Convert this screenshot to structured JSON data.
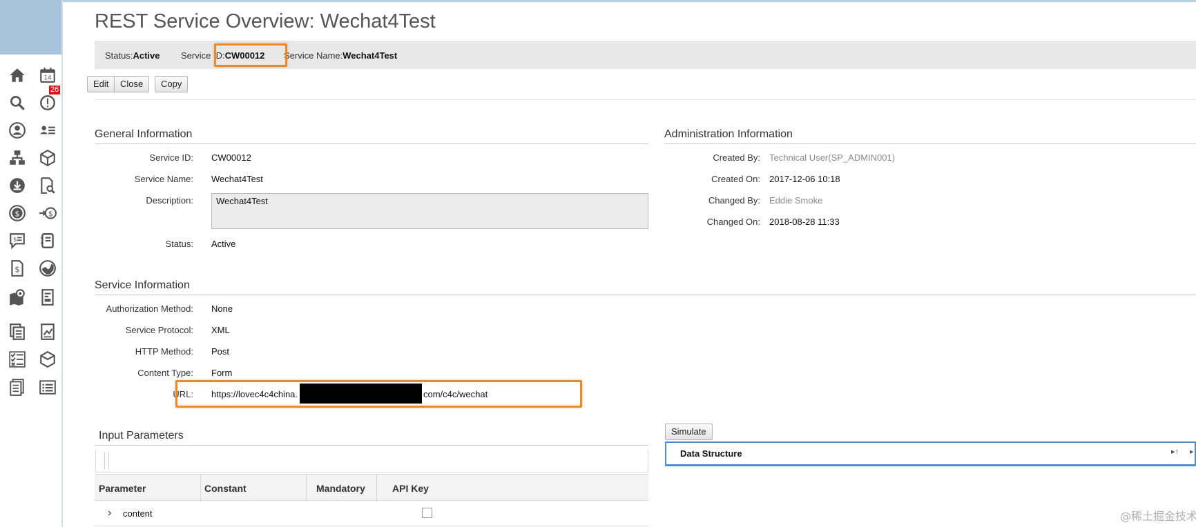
{
  "page": {
    "title": "REST Service Overview: Wechat4Test"
  },
  "rail": {
    "badge_count": "26",
    "icons": [
      "home-icon",
      "calendar-icon",
      "search-icon",
      "alert-icon",
      "person-icon",
      "contacts-list-icon",
      "org-chart-icon",
      "package-icon",
      "download-icon",
      "search-doc-icon",
      "dollar-icon",
      "transfer-dollar-icon",
      "chat-dollar-icon",
      "notebook-icon",
      "receipt-dollar-icon",
      "globe-chart-icon",
      "map-pin-icon",
      "report-icon",
      "documents-icon",
      "chart-doc-icon",
      "checklist-icon",
      "box-icon",
      "doc-list-icon",
      "list-icon"
    ]
  },
  "status_bar": {
    "status_label": "Status:",
    "status_value": "Active",
    "service_id_label": "Service ID:",
    "service_id_value": "CW00012",
    "service_name_label": "Service Name:",
    "service_name_value": "Wechat4Test"
  },
  "toolbar": {
    "edit": "Edit",
    "close": "Close",
    "copy": "Copy"
  },
  "general": {
    "title": "General Information",
    "service_id_label": "Service ID:",
    "service_id_value": "CW00012",
    "service_name_label": "Service Name:",
    "service_name_value": "Wechat4Test",
    "description_label": "Description:",
    "description_value": "Wechat4Test",
    "status_label": "Status:",
    "status_value": "Active"
  },
  "admin": {
    "title": "Administration Information",
    "created_by_label": "Created By:",
    "created_by_value": "Technical User(SP_ADMIN001)",
    "created_on_label": "Created On:",
    "created_on_value": "2017-12-06 10:18",
    "changed_by_label": "Changed By:",
    "changed_by_value": "Eddie Smoke",
    "changed_on_label": "Changed On:",
    "changed_on_value": "2018-08-28 11:33"
  },
  "service_info": {
    "title": "Service Information",
    "auth_label": "Authorization Method:",
    "auth_value": "None",
    "protocol_label": "Service Protocol:",
    "protocol_value": "XML",
    "http_label": "HTTP Method:",
    "http_value": "Post",
    "content_label": "Content Type:",
    "content_value": "Form",
    "url_label": "URL:",
    "url_prefix": "https://lovec4c4china.",
    "url_suffix": "com/c4c/wechat"
  },
  "input_params": {
    "title": "Input Parameters",
    "columns": [
      "Parameter",
      "Constant",
      "Mandatory",
      "API Key"
    ],
    "rows": [
      {
        "parameter": "content",
        "mandatory": false
      }
    ]
  },
  "data_structure": {
    "simulate_label": "Simulate",
    "title": "Data Structure"
  },
  "watermark": "@稀土掘金技术社区",
  "colors": {
    "highlight": "#e8892b",
    "rail_top": "#a7c4dd",
    "panel_border": "#4a90d0"
  }
}
